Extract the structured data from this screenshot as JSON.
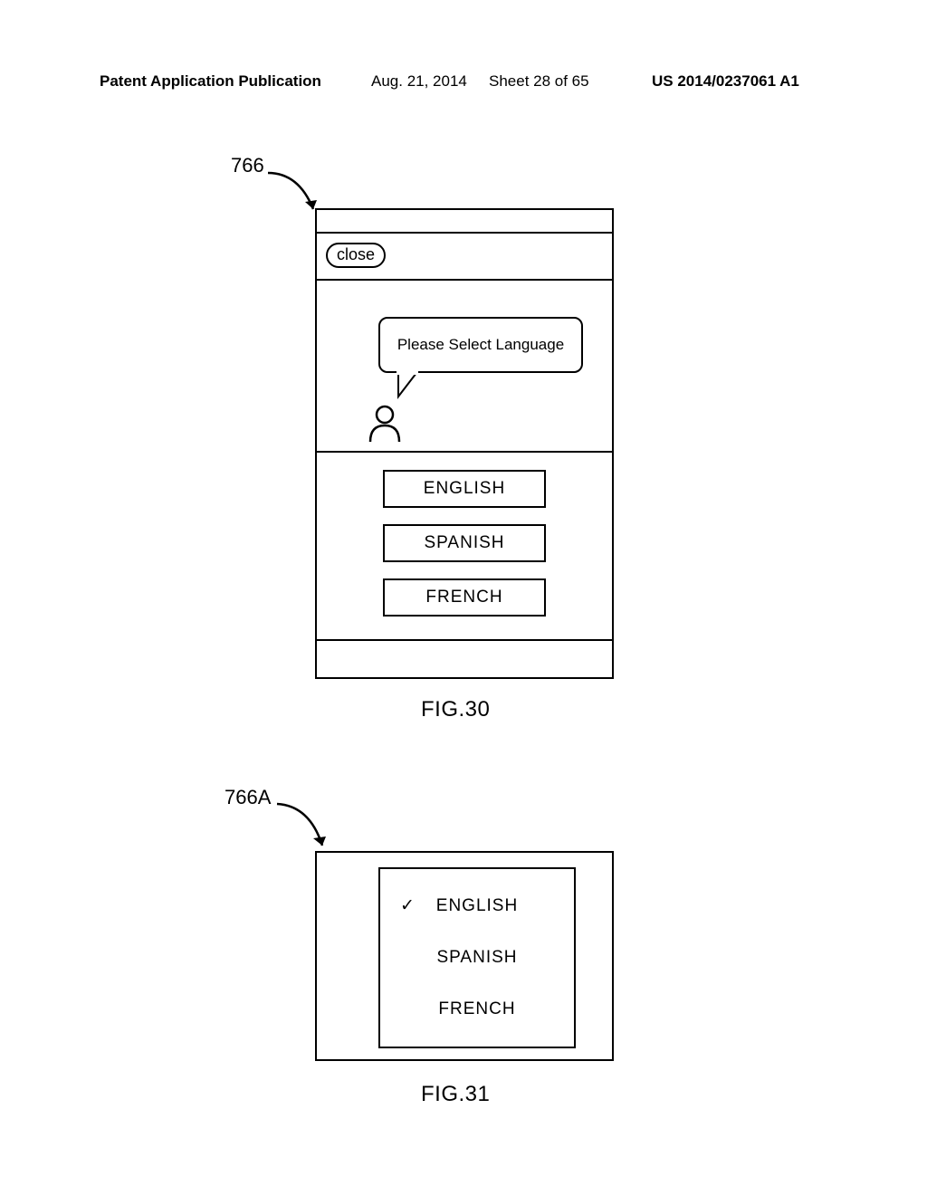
{
  "header": {
    "publication": "Patent Application Publication",
    "date": "Aug. 21, 2014",
    "sheet": "Sheet 28 of 65",
    "patnum": "US 2014/0237061 A1"
  },
  "fig30": {
    "callout": "766",
    "close_label": "close",
    "bubble_text": "Please Select Language",
    "options": {
      "opt1": "ENGLISH",
      "opt2": "SPANISH",
      "opt3": "FRENCH"
    },
    "label": "FIG.30"
  },
  "fig31": {
    "callout": "766A",
    "options": {
      "opt1": "ENGLISH",
      "opt2": "SPANISH",
      "opt3": "FRENCH"
    },
    "checkmark": "✓",
    "label": "FIG.31"
  }
}
